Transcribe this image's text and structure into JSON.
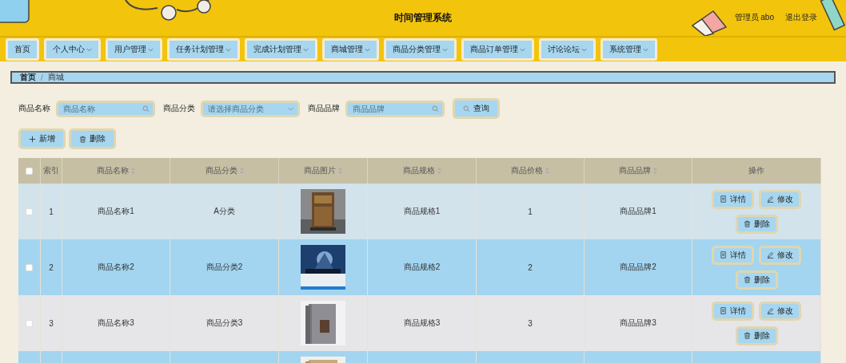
{
  "header": {
    "title": "时间管理系统",
    "user": "管理员 abo",
    "logout": "退出登录"
  },
  "nav": [
    {
      "label": "首页",
      "dropdown": false
    },
    {
      "label": "个人中心",
      "dropdown": true
    },
    {
      "label": "用户管理",
      "dropdown": true
    },
    {
      "label": "任务计划管理",
      "dropdown": true
    },
    {
      "label": "完成计划管理",
      "dropdown": true
    },
    {
      "label": "商城管理",
      "dropdown": true
    },
    {
      "label": "商品分类管理",
      "dropdown": true
    },
    {
      "label": "商品订单管理",
      "dropdown": true
    },
    {
      "label": "讨论论坛",
      "dropdown": true
    },
    {
      "label": "系统管理",
      "dropdown": true
    }
  ],
  "breadcrumb": {
    "items": [
      "首页",
      "商城"
    ],
    "separator": "/"
  },
  "filters": [
    {
      "label": "商品名称",
      "placeholder": "商品名称",
      "kind": "search"
    },
    {
      "label": "商品分类",
      "placeholder": "请选择商品分类",
      "kind": "select"
    },
    {
      "label": "商品品牌",
      "placeholder": "商品品牌",
      "kind": "search"
    }
  ],
  "query_button": "查询",
  "actions": [
    {
      "label": "新增",
      "kind": "add"
    },
    {
      "label": "删除",
      "kind": "delete"
    }
  ],
  "table": {
    "columns": [
      {
        "label": "索引",
        "sortable": false
      },
      {
        "label": "商品名称",
        "sortable": true
      },
      {
        "label": "商品分类",
        "sortable": true
      },
      {
        "label": "商品图片",
        "sortable": true
      },
      {
        "label": "商品规格",
        "sortable": true
      },
      {
        "label": "商品价格",
        "sortable": true
      },
      {
        "label": "商品品牌",
        "sortable": true
      },
      {
        "label": "操作",
        "sortable": false
      }
    ],
    "all_checked": false,
    "rows": [
      {
        "index": "1",
        "name": "商品名称1",
        "category": "A分类",
        "spec": "商品规格1",
        "price": "1",
        "brand": "商品品牌1",
        "checked": false,
        "hovered": true,
        "actions": [
          {
            "label": "详情",
            "kind": "detail"
          },
          {
            "label": "修改",
            "kind": "edit"
          },
          {
            "label": "删除",
            "kind": "delete"
          }
        ]
      },
      {
        "index": "2",
        "name": "商品名称2",
        "category": "商品分类2",
        "spec": "商品规格2",
        "price": "2",
        "brand": "商品品牌2",
        "checked": false,
        "hovered": false,
        "actions": [
          {
            "label": "详情",
            "kind": "detail"
          },
          {
            "label": "修改",
            "kind": "edit"
          },
          {
            "label": "删除",
            "kind": "delete"
          }
        ]
      },
      {
        "index": "3",
        "name": "商品名称3",
        "category": "商品分类3",
        "spec": "商品规格3",
        "price": "3",
        "brand": "商品品牌3",
        "checked": false,
        "hovered": false,
        "actions": [
          {
            "label": "详情",
            "kind": "detail"
          },
          {
            "label": "修改",
            "kind": "edit"
          },
          {
            "label": "删除",
            "kind": "delete"
          }
        ]
      },
      {
        "kind": "partial"
      }
    ]
  }
}
